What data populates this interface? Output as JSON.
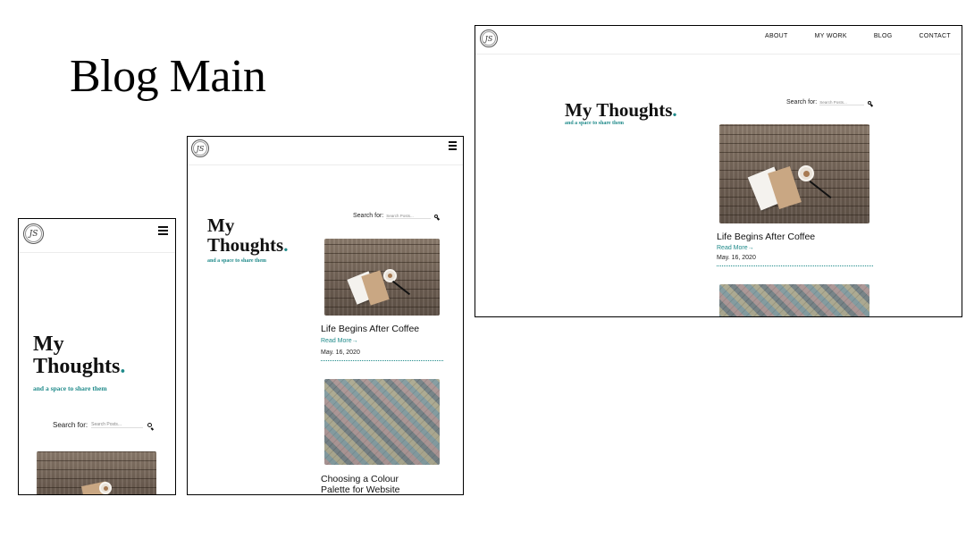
{
  "slide": {
    "title": "Blog Main"
  },
  "brand": {
    "logo_text": "JS"
  },
  "page": {
    "title_line1": "My",
    "title_line2": "Thoughts",
    "title_full": "My Thoughts",
    "title_dot": ".",
    "subtitle": "and a space to share them"
  },
  "search": {
    "label": "Search for:",
    "placeholder": "Search Posts..."
  },
  "nav": {
    "items": [
      "ABOUT",
      "MY WORK",
      "BLOG",
      "CONTACT"
    ]
  },
  "posts": [
    {
      "title": "Life Begins After Coffee",
      "read_more": "Read More→",
      "date": "May. 16, 2020"
    },
    {
      "title": "Choosing a Colour Palette for Website"
    }
  ]
}
